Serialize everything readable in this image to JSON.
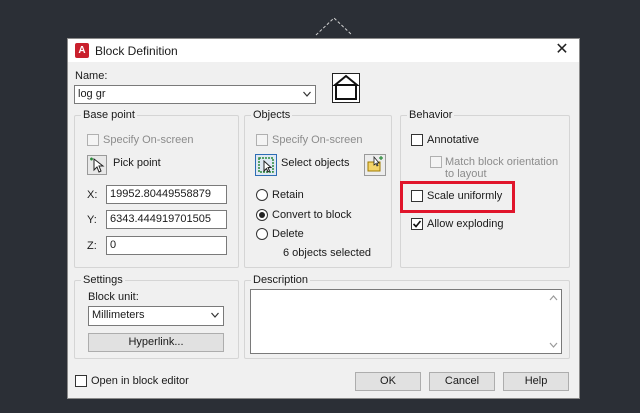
{
  "dialog": {
    "title": "Block Definition",
    "close_glyph": "✕"
  },
  "name": {
    "label": "Name:",
    "value": "log gr"
  },
  "base_point": {
    "title": "Base point",
    "specify_on_screen": "Specify On-screen",
    "pick_point": "Pick point",
    "x_label": "X:",
    "x_value": "19952.80449558879",
    "y_label": "Y:",
    "y_value": "6343.444919701505",
    "z_label": "Z:",
    "z_value": "0"
  },
  "objects": {
    "title": "Objects",
    "specify_on_screen": "Specify On-screen",
    "select_objects": "Select objects",
    "retain": "Retain",
    "convert_to_block": "Convert to block",
    "delete": "Delete",
    "selected_status": "6 objects selected",
    "selected_option": "convert_to_block"
  },
  "behavior": {
    "title": "Behavior",
    "annotative": "Annotative",
    "annotative_checked": false,
    "match_orientation_line1": "Match block orientation",
    "match_orientation_line2": "to layout",
    "scale_uniformly": "Scale uniformly",
    "scale_uniformly_checked": false,
    "allow_exploding": "Allow exploding",
    "allow_exploding_checked": true
  },
  "settings": {
    "title": "Settings",
    "block_unit_label": "Block unit:",
    "block_unit_value": "Millimeters",
    "hyperlink_button": "Hyperlink..."
  },
  "description": {
    "title": "Description",
    "value": ""
  },
  "footer": {
    "open_in_block_editor": "Open in block editor",
    "open_in_block_editor_checked": false,
    "ok": "OK",
    "cancel": "Cancel",
    "help": "Help"
  },
  "colors": {
    "highlight": "#e0152b",
    "app_icon": "#c9202d",
    "background": "#2b2f36"
  }
}
